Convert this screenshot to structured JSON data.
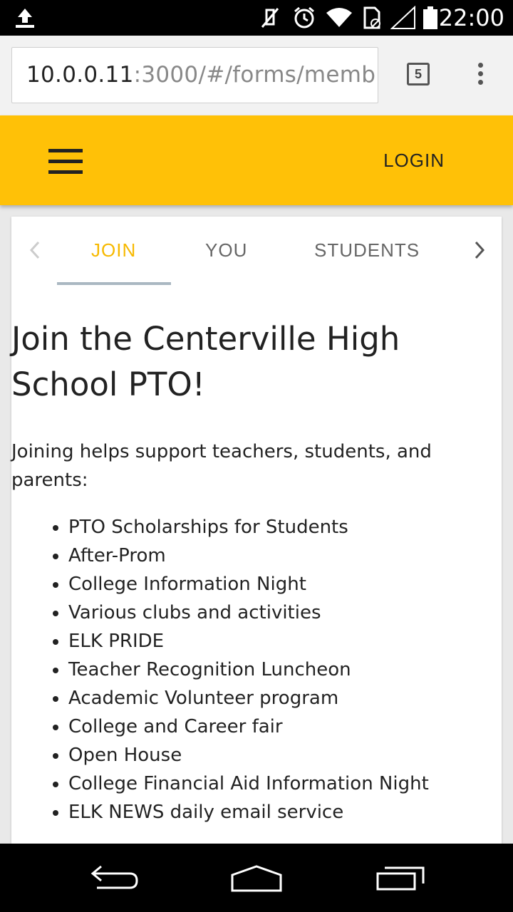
{
  "status_bar": {
    "time": "22:00",
    "icons": [
      "upload-icon",
      "mute-icon",
      "alarm-icon",
      "wifi-icon",
      "sim-icon",
      "signal-icon",
      "battery-icon"
    ]
  },
  "browser": {
    "url_host": "10.0.0.11",
    "url_rest": ":3000/#/forms/memb",
    "tab_count": "5"
  },
  "app_bar": {
    "login_label": "LOGIN"
  },
  "tabs": {
    "items": [
      {
        "label": "JOIN",
        "active": true
      },
      {
        "label": "YOU",
        "active": false
      },
      {
        "label": "STUDENTS",
        "active": false
      }
    ]
  },
  "content": {
    "title": "Join the Centerville High School PTO!",
    "intro": "Joining helps support teachers, students, and parents:",
    "benefits": [
      "PTO Scholarships for Students",
      "After-Prom",
      "College Information Night",
      "Various clubs and activities",
      "ELK PRIDE",
      "Teacher Recognition Luncheon",
      "Academic Volunteer program",
      "College and Career fair",
      "Open House",
      "College Financial Aid Information Night",
      "ELK NEWS daily email service"
    ]
  },
  "colors": {
    "accent": "#ffc107",
    "active_tab_text": "#f7b900",
    "tab_indicator": "#aab8c2"
  }
}
